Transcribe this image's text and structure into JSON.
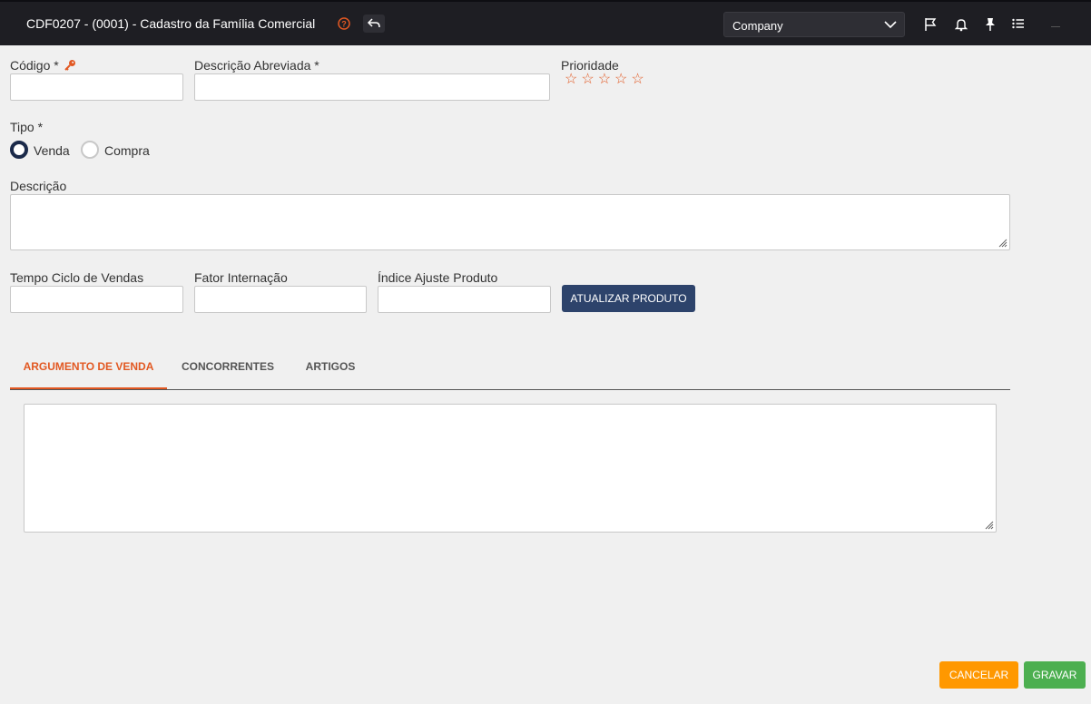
{
  "header": {
    "title": "CDF0207 - (0001) - Cadastro da Família Comercial",
    "company_select": "Company",
    "icons": [
      "help-icon",
      "back-icon",
      "chevron-down-icon",
      "flag-icon",
      "bell-icon",
      "pin-icon",
      "list-icon"
    ]
  },
  "form": {
    "codigo_label": "Código *",
    "codigo_value": "",
    "descricao_abreviada_label": "Descrição Abreviada *",
    "descricao_abreviada_value": "",
    "prioridade_label": "Prioridade",
    "prioridade_rating": 0,
    "prioridade_max": 5,
    "tipo_label": "Tipo *",
    "tipo_options": [
      "Venda",
      "Compra"
    ],
    "tipo_selected": "Venda",
    "descricao_label": "Descrição",
    "descricao_value": "",
    "tempo_ciclo_label": "Tempo Ciclo de Vendas",
    "tempo_ciclo_value": "",
    "fator_internacao_label": "Fator Internação",
    "fator_internacao_value": "",
    "indice_ajuste_label": "Índice Ajuste Produto",
    "indice_ajuste_value": "",
    "update_button": "ATUALIZAR PRODUTO"
  },
  "tabs": [
    {
      "label": "ARGUMENTO DE VENDA",
      "active": true
    },
    {
      "label": "CONCORRENTES",
      "active": false
    },
    {
      "label": "ARTIGOS",
      "active": false
    }
  ],
  "tab_content_value": "",
  "footer": {
    "cancel": "CANCELAR",
    "save": "GRAVAR"
  },
  "colors": {
    "accent": "#e25822",
    "topbar": "#1e1e23",
    "primary_button": "#2d436b",
    "cancel_button": "#ff9800",
    "save_button": "#4caf50"
  }
}
